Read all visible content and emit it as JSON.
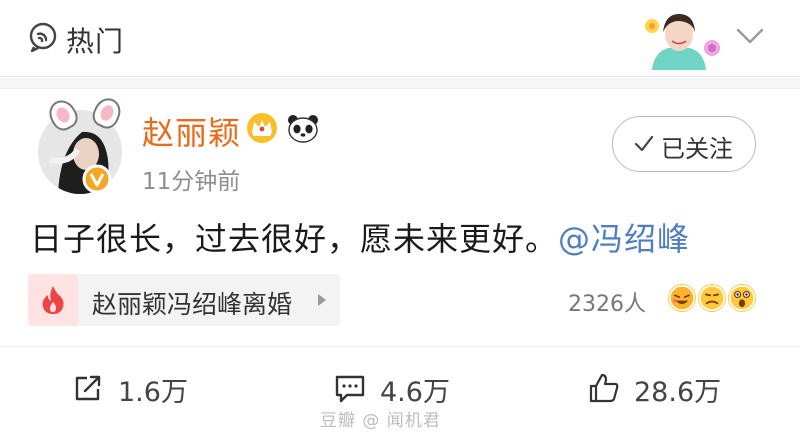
{
  "header": {
    "title": "热门",
    "left_icon": "hot-circle-icon",
    "right_icon": "chevron-down-icon"
  },
  "post": {
    "author": "赵丽颖",
    "author_color": "#e86b1a",
    "time": "11分钟前",
    "follow_label": "已关注",
    "text": "日子很长，过去很好，愿未来更好。",
    "mention": "@冯绍峰",
    "mention_color": "#4f7fbf",
    "topic": {
      "label": "赵丽颖冯绍峰离婚",
      "icon": "fire-icon"
    },
    "reader_count": "2326人",
    "actions": {
      "repost": "1.6万",
      "comment": "4.6万",
      "like": "28.6万"
    }
  },
  "watermark": "豆瓣 @ 闻机君"
}
